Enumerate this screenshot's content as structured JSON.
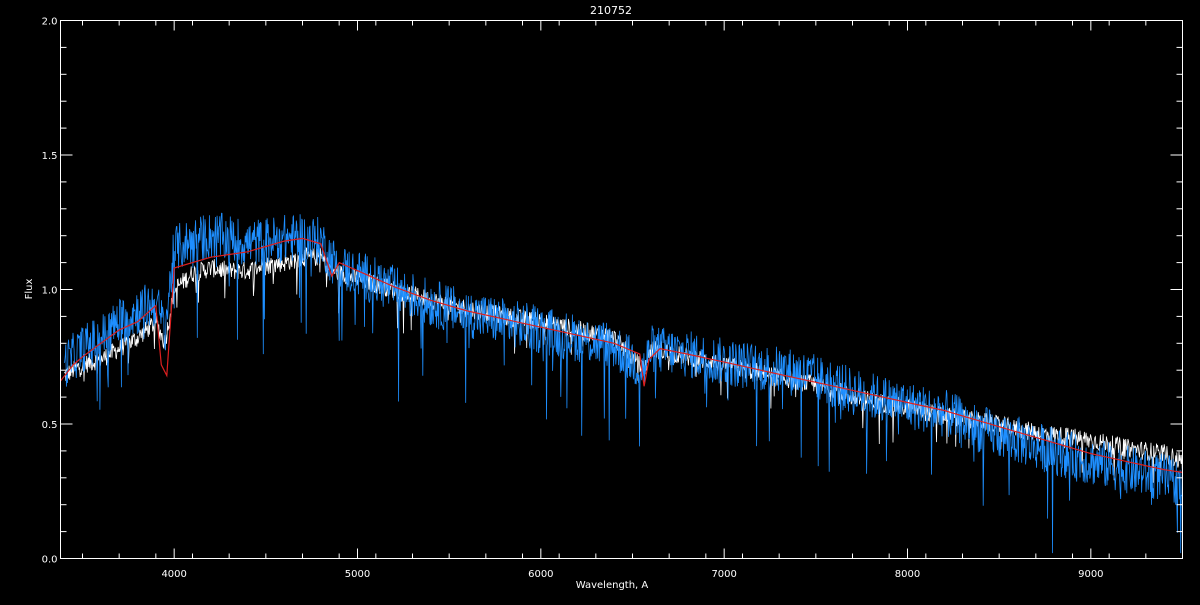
{
  "chart_data": {
    "type": "line",
    "title": "210752",
    "xlabel": "Wavelength, A",
    "ylabel": "Flux",
    "xlim": [
      3380,
      9500
    ],
    "ylim": [
      0.0,
      2.0
    ],
    "x_ticks": [
      4000,
      5000,
      6000,
      7000,
      8000,
      9000
    ],
    "x_tick_labels": [
      "4000",
      "5000",
      "6000",
      "7000",
      "8000",
      "9000"
    ],
    "y_ticks": [
      0.0,
      0.5,
      1.0,
      1.5,
      2.0
    ],
    "y_tick_labels": [
      "0.0",
      "0.5",
      "1.0",
      "1.5",
      "2.0"
    ],
    "grid": false,
    "background": "#000000",
    "series": [
      {
        "color": "#ffffff",
        "noise": 0.035,
        "x": [
          3400,
          3500,
          3600,
          3700,
          3800,
          3900,
          3950,
          4000,
          4100,
          4200,
          4300,
          4400,
          4500,
          4600,
          4700,
          4800,
          4850,
          4900,
          5000,
          5200,
          5400,
          5600,
          5800,
          6000,
          6200,
          6400,
          6560,
          6600,
          6800,
          7000,
          7200,
          7400,
          7600,
          7700,
          8000,
          8200,
          8400,
          8600,
          8800,
          9000,
          9200,
          9400,
          9500
        ],
        "y": [
          0.68,
          0.72,
          0.74,
          0.78,
          0.82,
          0.88,
          0.8,
          1.0,
          1.06,
          1.08,
          1.07,
          1.07,
          1.09,
          1.1,
          1.12,
          1.12,
          1.08,
          1.06,
          1.04,
          1.0,
          0.96,
          0.93,
          0.9,
          0.88,
          0.85,
          0.82,
          0.7,
          0.78,
          0.75,
          0.72,
          0.69,
          0.66,
          0.63,
          0.6,
          0.56,
          0.53,
          0.51,
          0.48,
          0.46,
          0.44,
          0.41,
          0.39,
          0.36
        ]
      },
      {
        "color": "#1e8fff",
        "noise": 0.09,
        "x": [
          3400,
          3500,
          3600,
          3700,
          3800,
          3900,
          3950,
          4000,
          4100,
          4200,
          4300,
          4400,
          4500,
          4600,
          4700,
          4800,
          4850,
          4900,
          5000,
          5200,
          5400,
          5600,
          5800,
          6000,
          6200,
          6400,
          6560,
          6600,
          6800,
          7000,
          7200,
          7400,
          7600,
          7700,
          8000,
          8200,
          8400,
          8600,
          8800,
          9000,
          9200,
          9400,
          9500
        ],
        "y": [
          0.72,
          0.78,
          0.82,
          0.88,
          0.92,
          0.95,
          0.85,
          1.15,
          1.18,
          1.2,
          1.19,
          1.17,
          1.18,
          1.19,
          1.19,
          1.18,
          1.12,
          1.08,
          1.06,
          1.0,
          0.95,
          0.91,
          0.88,
          0.85,
          0.82,
          0.79,
          0.7,
          0.78,
          0.76,
          0.73,
          0.71,
          0.69,
          0.65,
          0.62,
          0.57,
          0.54,
          0.48,
          0.44,
          0.4,
          0.36,
          0.33,
          0.3,
          0.28
        ]
      },
      {
        "color": "#dd2020",
        "noise": 0.0,
        "x": [
          3380,
          3450,
          3500,
          3600,
          3700,
          3800,
          3900,
          3930,
          3960,
          4000,
          4100,
          4200,
          4300,
          4400,
          4500,
          4600,
          4700,
          4800,
          4860,
          4900,
          5000,
          5200,
          5400,
          5600,
          5800,
          6000,
          6200,
          6400,
          6540,
          6563,
          6590,
          6650,
          6800,
          7000,
          7200,
          7400,
          7600,
          7800,
          8000,
          8200,
          8400,
          8600,
          8800,
          9000,
          9200,
          9400,
          9500
        ],
        "y": [
          0.66,
          0.72,
          0.75,
          0.8,
          0.85,
          0.88,
          0.94,
          0.72,
          0.68,
          1.08,
          1.1,
          1.12,
          1.13,
          1.14,
          1.16,
          1.18,
          1.19,
          1.17,
          1.05,
          1.1,
          1.07,
          1.01,
          0.96,
          0.92,
          0.89,
          0.86,
          0.83,
          0.8,
          0.76,
          0.64,
          0.74,
          0.78,
          0.76,
          0.73,
          0.7,
          0.67,
          0.64,
          0.61,
          0.58,
          0.55,
          0.51,
          0.47,
          0.43,
          0.39,
          0.36,
          0.33,
          0.32
        ]
      }
    ]
  }
}
